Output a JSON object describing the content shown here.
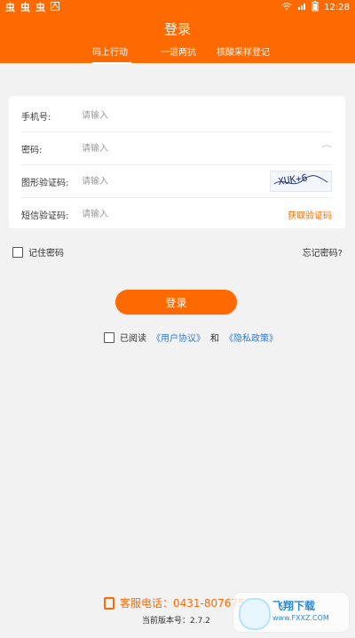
{
  "status": {
    "left_icons": [
      "bug-icon",
      "bug-icon",
      "bug-icon",
      "keyboard-icon"
    ],
    "left_glyphs": [
      "虫",
      "虫",
      "虫"
    ],
    "time": "12:28"
  },
  "header": {
    "title": "登录",
    "tabs": [
      {
        "label": "码上行动",
        "active": true
      },
      {
        "label": "一退两抗",
        "active": false
      },
      {
        "label": "核酸采样登记",
        "active": false
      }
    ]
  },
  "form": {
    "phone": {
      "label": "手机号:",
      "placeholder": "请输入"
    },
    "password": {
      "label": "密码:",
      "placeholder": "请输入"
    },
    "image_captcha": {
      "label": "图形验证码:",
      "placeholder": "请输入",
      "captcha_text": "XUK+6"
    },
    "sms_code": {
      "label": "短信验证码:",
      "placeholder": "请输入",
      "action": "获取验证码"
    }
  },
  "remember": {
    "label": "记住密码"
  },
  "forgot": {
    "label": "忘记密码?"
  },
  "login_button": {
    "label": "登录"
  },
  "agreement": {
    "prefix": "已阅读",
    "user_agreement": "《用户协议》",
    "and": "和",
    "privacy": "《隐私政策》"
  },
  "footer": {
    "service": "客服电话：0431-80767550",
    "version": "当前版本号：2.7.2"
  },
  "watermark": {
    "brand": "飞翔下载",
    "domain": "www.FXXZ.COM"
  },
  "colors": {
    "accent": "#ff6a00",
    "link": "#2f7bd8",
    "background": "#f2f2f2"
  }
}
